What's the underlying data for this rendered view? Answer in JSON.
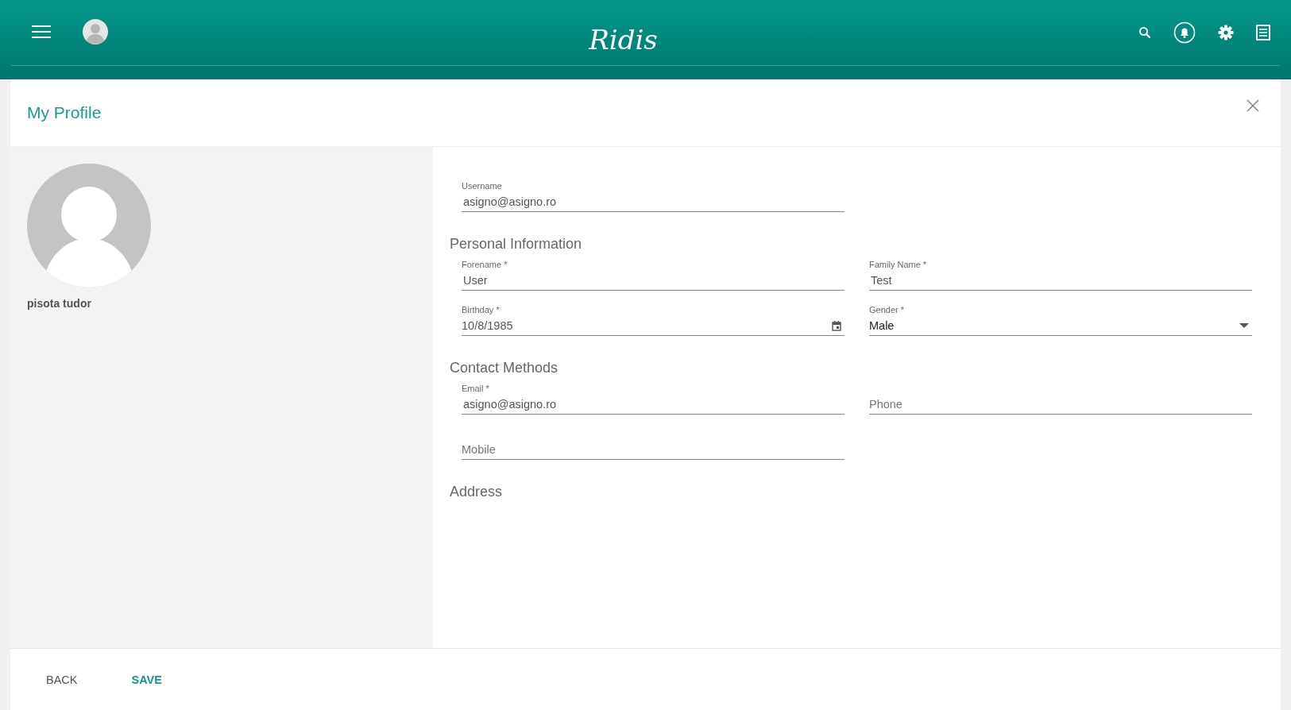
{
  "header": {
    "logo": "Ridis"
  },
  "dialog": {
    "title": "My Profile"
  },
  "profile": {
    "name": "pisota tudor"
  },
  "account": {
    "fields": [
      {
        "label": "Username",
        "value": "asigno@asigno.ro"
      }
    ]
  },
  "sections": [
    {
      "heading": "Personal Information",
      "fields": [
        {
          "label": "Forename *",
          "value": "User",
          "kind": "text"
        },
        {
          "label": "Family Name *",
          "value": "Test",
          "kind": "text"
        },
        {
          "label": "Birthday *",
          "value": "10/8/1985",
          "kind": "date"
        },
        {
          "label": "Gender *",
          "value": "Male",
          "kind": "select"
        }
      ]
    },
    {
      "heading": "Contact Methods",
      "fields": [
        {
          "label": "Email *",
          "value": "asigno@asigno.ro",
          "kind": "text"
        },
        {
          "placeholder": "Phone",
          "kind": "text"
        },
        {
          "placeholder": "Mobile",
          "kind": "text"
        }
      ]
    },
    {
      "heading": "Address"
    }
  ],
  "buttons": [
    {
      "label": "BACK",
      "kind": "secondary"
    },
    {
      "label": "SAVE",
      "kind": "primary"
    }
  ]
}
